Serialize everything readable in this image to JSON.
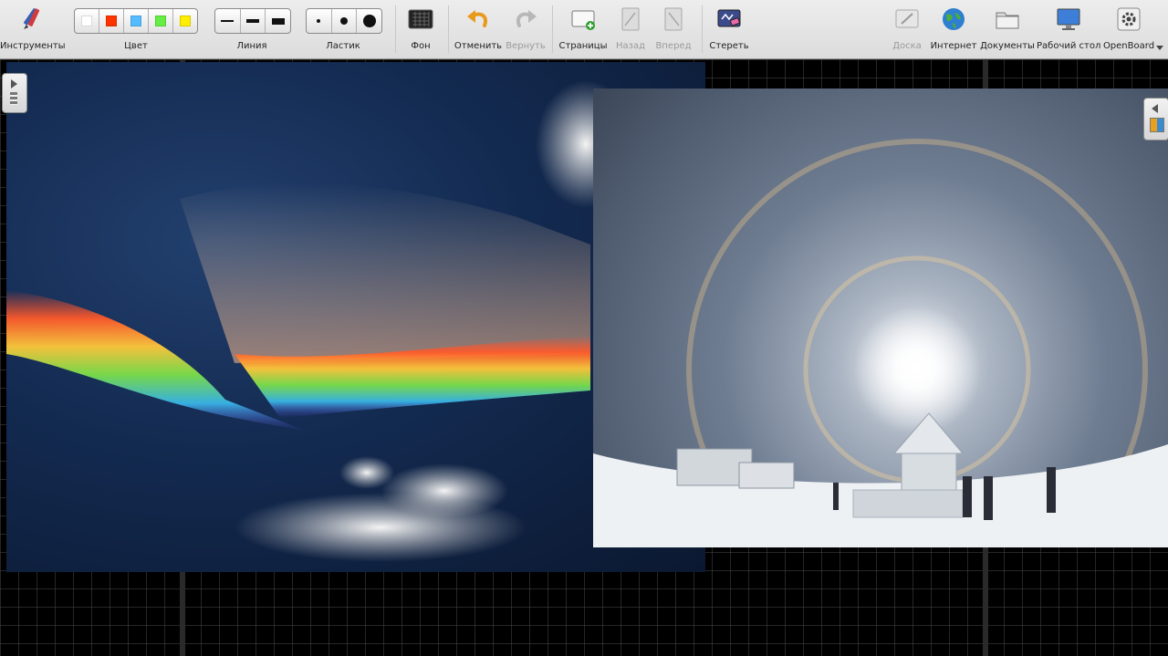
{
  "toolbar": {
    "tools_label": "Инструменты",
    "color": {
      "label": "Цвет",
      "swatches": [
        "#ffffff",
        "#ff3300",
        "#55bbff",
        "#66ee44",
        "#ffee00"
      ]
    },
    "line_label": "Линия",
    "eraser_label": "Ластик",
    "background_label": "Фон",
    "undo_label": "Отменить",
    "redo_label": "Вернуть",
    "pages_label": "Страницы",
    "back_label": "Назад",
    "forward_label": "Вперед",
    "clear_label": "Стереть",
    "board_label": "Доска",
    "internet_label": "Интернет",
    "documents_label": "Документы",
    "desktop_label": "Рабочий стол",
    "openboard_label": "OpenBoard"
  },
  "board": {
    "images": [
      {
        "name": "fire-rainbow-clouds-photo",
        "icon": "photo"
      },
      {
        "name": "sun-halo-winter-photo",
        "icon": "photo"
      }
    ]
  }
}
